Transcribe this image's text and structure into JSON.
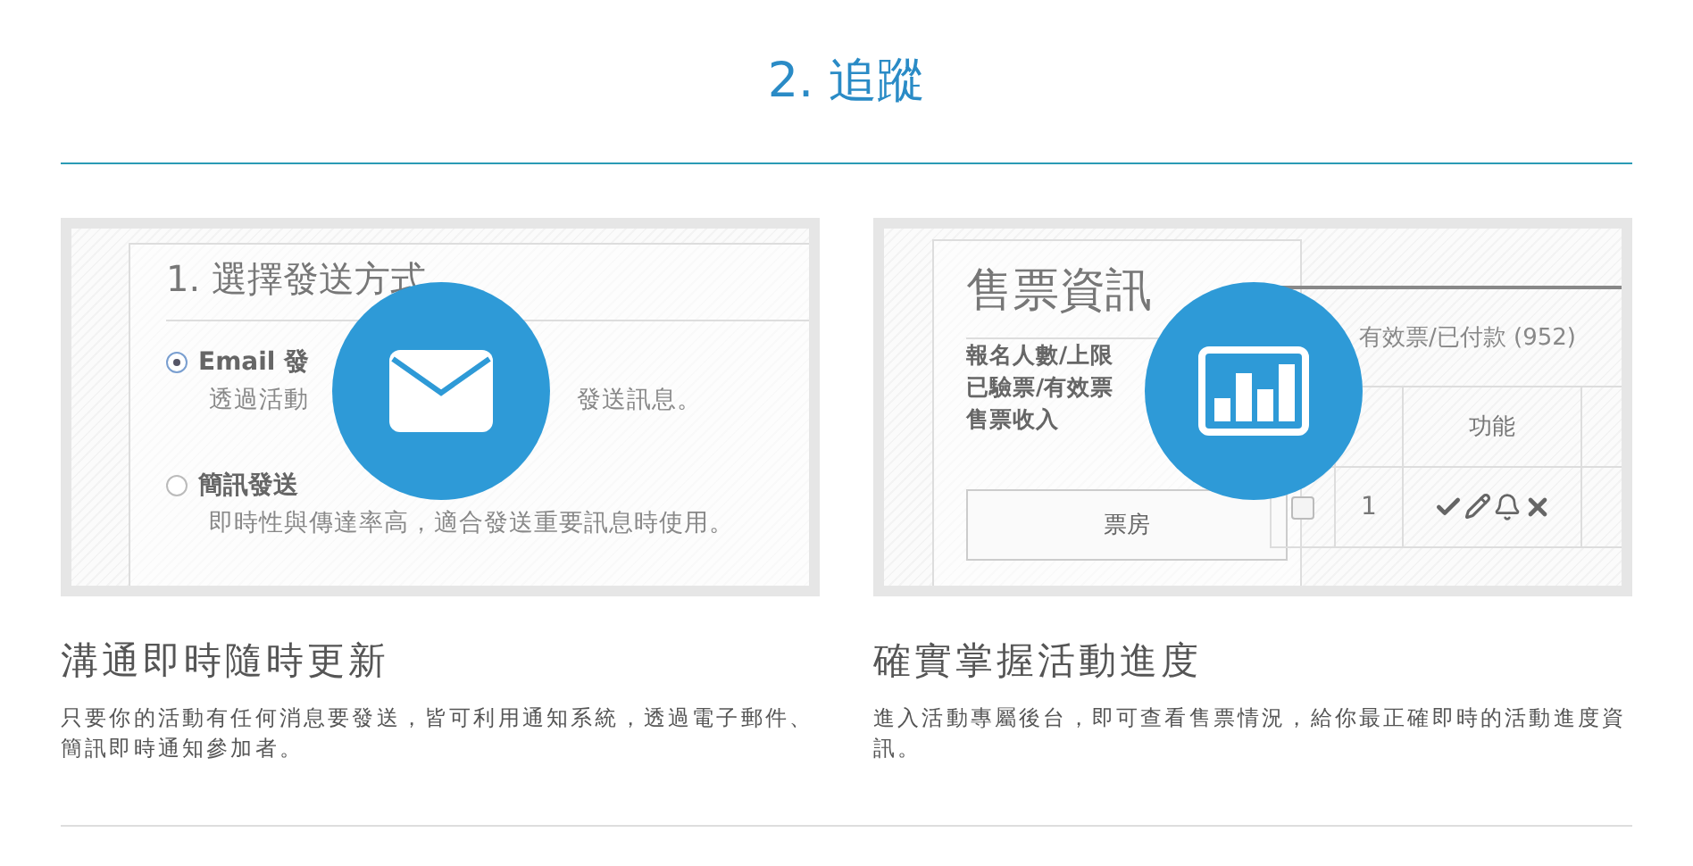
{
  "title": "2. 追蹤",
  "features": [
    {
      "kind": "messaging",
      "screenshot": {
        "title": "1. 選擇發送方式",
        "options": [
          {
            "label": "Email 發",
            "description_parts": [
              "透過活動",
              "發送訊息。"
            ],
            "selected": true
          },
          {
            "label": "簡訊發送",
            "description_parts": [
              "即時性與傳達率高，適合發送重要訊息時使用。"
            ],
            "selected": false
          }
        ]
      },
      "heading": "溝通即時隨時更新",
      "description": "只要你的活動有任何消息要發送，皆可利用通知系統，透過電子郵件、簡訊即時通知參加者。"
    },
    {
      "kind": "tracking",
      "screenshot": {
        "title": "售票資訊",
        "stats": [
          "報名人數/上限",
          "已驗票/有效票",
          "售票收入"
        ],
        "button": "票房",
        "summary": "有效票/已付款 (952)",
        "column": "功能",
        "rows": [
          {
            "number": "1",
            "checked": false
          }
        ]
      },
      "heading": "確實掌握活動進度",
      "description": "進入活動專屬後台，即可查看售票情況，給你最正確即時的活動進度資訊。"
    }
  ]
}
